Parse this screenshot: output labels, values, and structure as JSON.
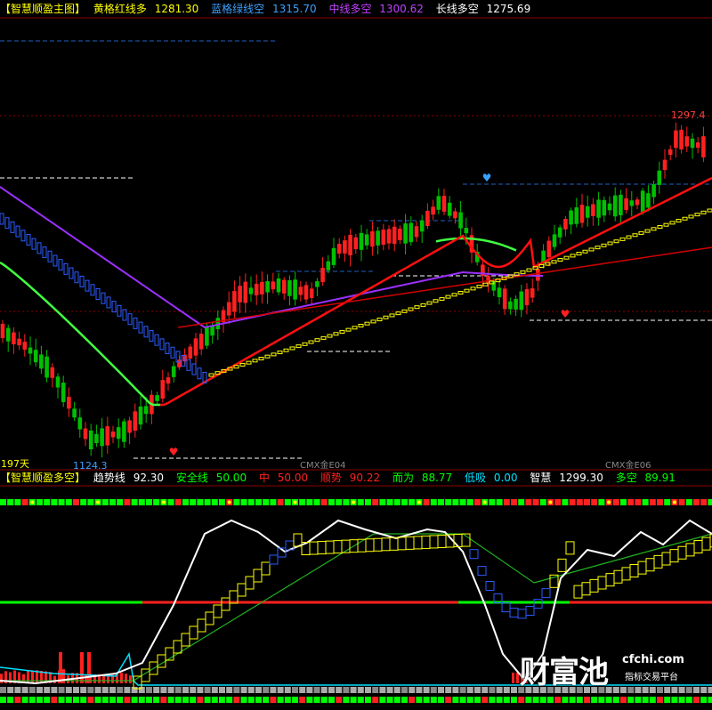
{
  "header_main": {
    "title": "【智慧顺盈主图】",
    "items": [
      {
        "label": "黄格红线多",
        "value": "1281.30",
        "color": "#ffff00"
      },
      {
        "label": "蓝格绿线空",
        "value": "1315.70",
        "color": "#3aa0ff"
      },
      {
        "label": "中线多空",
        "value": "1300.62",
        "color": "#c040ff"
      },
      {
        "label": "长线多空",
        "value": "1275.69",
        "color": "#ffffff"
      }
    ]
  },
  "header_sub": {
    "title": "【智慧顺盈多空】",
    "items": [
      {
        "label": "趋势线",
        "value": "92.30",
        "color": "#ffffff"
      },
      {
        "label": "安全线",
        "value": "50.00",
        "color": "#00ff00"
      },
      {
        "label": "中",
        "value": "50.00",
        "color": "#ff2020"
      },
      {
        "label": "顺势",
        "value": "90.22",
        "color": "#ff2020"
      },
      {
        "label": "而为",
        "value": "88.77",
        "color": "#00ff00"
      },
      {
        "label": "低吸",
        "value": "0.00",
        "color": "#00e0ff"
      },
      {
        "label": "智慧",
        "value": "1299.30",
        "color": "#ffffff"
      },
      {
        "label": "多空",
        "value": "89.91",
        "color": "#00ff00"
      }
    ]
  },
  "labels": {
    "high_value": "1297.4",
    "low_value": "1124.3",
    "period": "197天",
    "x_tick_1": "CMX金E04",
    "x_tick_2": "CMX金E06"
  },
  "watermark": {
    "brand": "财富池",
    "url": "cfchi.com",
    "tagline": "指标交易平台"
  },
  "colors": {
    "bull": "#ff2020",
    "bear": "#00c000",
    "yellow": "#ffff00",
    "blue": "#2a5cff",
    "purple": "#9b30ff",
    "green_line": "#40ff40",
    "red_line": "#ff1010",
    "grid_red": "#8b0000",
    "grid_blue": "#1f5fbf"
  },
  "chart_data": [
    {
      "type": "candlestick",
      "title": "【智慧顺盈主图】",
      "y_range": [
        1124.3,
        1297.4
      ],
      "annotations": [
        "1297.4",
        "1124.3",
        "197天"
      ],
      "series": [
        {
          "name": "黄格红线多",
          "last": 1281.3
        },
        {
          "name": "蓝格绿线空",
          "last": 1315.7
        },
        {
          "name": "中线多空",
          "last": 1300.62
        },
        {
          "name": "长线多空",
          "last": 1275.69
        }
      ]
    },
    {
      "type": "line",
      "title": "【智慧顺盈多空】",
      "series": [
        {
          "name": "趋势线",
          "last": 92.3
        },
        {
          "name": "安全线",
          "last": 50.0
        },
        {
          "name": "中",
          "last": 50.0
        },
        {
          "name": "顺势",
          "last": 90.22
        },
        {
          "name": "而为",
          "last": 88.77
        },
        {
          "name": "低吸",
          "last": 0.0
        },
        {
          "name": "智慧",
          "last": 1299.3
        },
        {
          "name": "多空",
          "last": 89.91
        }
      ]
    }
  ]
}
